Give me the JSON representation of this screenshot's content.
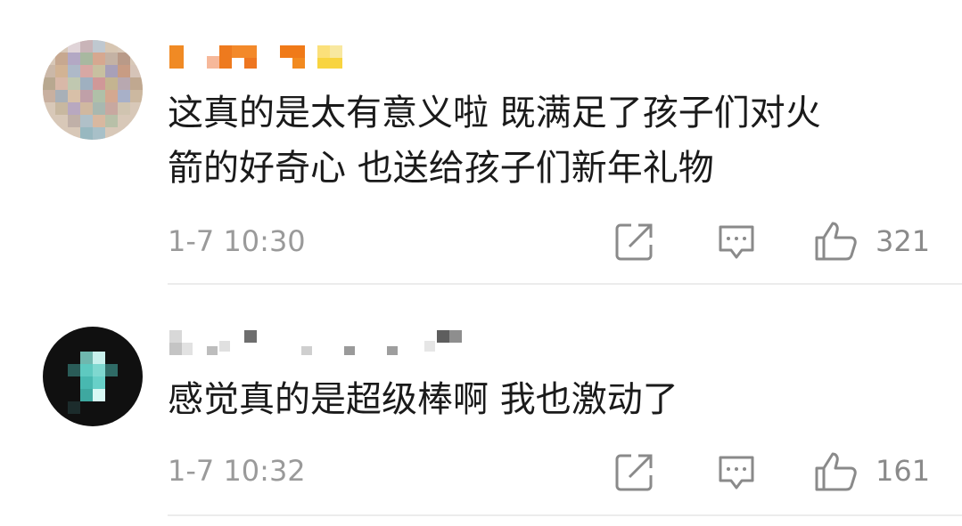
{
  "comments": [
    {
      "text": "这真的是太有意义啦 既满足了孩子们对火\n箭的好奇心 也送给孩子们新年礼物",
      "time": "1-7 10:30",
      "likes": "321",
      "avatar_icon": "pixelated-avatar-icon",
      "username_icon": "pixelated-username"
    },
    {
      "text": "感觉真的是超级棒啊 我也激动了",
      "time": "1-7 10:32",
      "likes": "161",
      "avatar_icon": "pixelated-avatar-icon",
      "username_icon": "pixelated-username"
    }
  ],
  "icons": {
    "share": "share-icon",
    "comment": "comment-icon",
    "like": "thumbs-up-icon"
  },
  "colors": {
    "text": "#1a1a1a",
    "meta": "#9a9a9a",
    "icon": "#8a8a8a",
    "divider": "#ececec"
  }
}
